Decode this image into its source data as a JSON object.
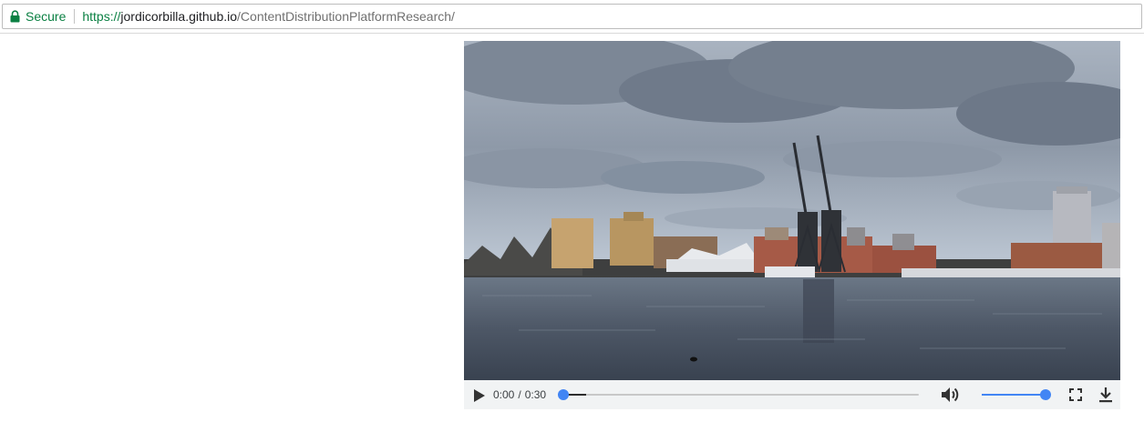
{
  "address_bar": {
    "secure_label": "Secure",
    "url_scheme": "https://",
    "url_host": "jordicorbilla.github.io",
    "url_path": "/ContentDistributionPlatformResearch/",
    "secure_color": "#0b8043"
  },
  "video": {
    "scene": "Dock with cranes and buildings under cloudy sky",
    "current_time": "0:00",
    "time_separator": "/",
    "duration": "0:30",
    "playback_progress": 0,
    "buffered_fraction": 0.065,
    "volume_fraction": 1,
    "accent_color": "#4285f4",
    "icons": {
      "play": "play-icon",
      "mute": "volume-icon",
      "fullscreen": "fullscreen-icon",
      "download": "download-icon"
    }
  }
}
